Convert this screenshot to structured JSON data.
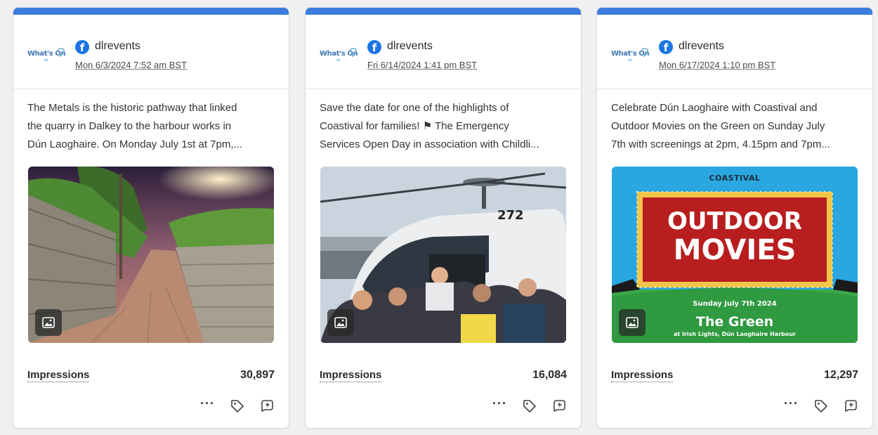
{
  "cards": [
    {
      "logo_text": "What's On",
      "logo_sub": "dlr",
      "platform_icon": "facebook-icon",
      "account": "dlrevents",
      "date": "Mon 6/3/2024 7:52 am BST",
      "text_lines": [
        "The Metals is the historic pathway that linked",
        "the quarry in Dalkey to the harbour works in",
        "Dún Laoghaire. On Monday July 1st at 7pm,..."
      ],
      "impressions_label": "Impressions",
      "impressions_value": "30,897",
      "more_label": "···"
    },
    {
      "logo_text": "What's On",
      "logo_sub": "dlr",
      "platform_icon": "facebook-icon",
      "account": "dlrevents",
      "date": "Fri 6/14/2024 1:41 pm BST",
      "text_lines": [
        "Save the date for one of the highlights of",
        "Coastival for families! ⚑ The Emergency",
        "Services Open Day in association with Childli..."
      ],
      "photo_number": "272",
      "impressions_label": "Impressions",
      "impressions_value": "16,084",
      "more_label": "···"
    },
    {
      "logo_text": "What's On",
      "logo_sub": "dlr",
      "platform_icon": "facebook-icon",
      "account": "dlrevents",
      "date": "Mon 6/17/2024 1:10 pm BST",
      "text_lines": [
        "Celebrate Dún Laoghaire with Coastival and",
        "Outdoor Movies on the Green on Sunday July",
        "7th with screenings at 2pm, 4.15pm and 7pm..."
      ],
      "poster": {
        "brand": "COASTIVAL",
        "line1": "OUTDOOR",
        "line2": "MOVIES",
        "date": "Sunday July 7th 2024",
        "venue": "The Green",
        "venue_sub": "at Irish Lights, Dún Laoghaire Harbour"
      },
      "impressions_label": "Impressions",
      "impressions_value": "12,297",
      "more_label": "···"
    }
  ],
  "colors": {
    "accent_bar": "#3b7ddd",
    "facebook": "#1b74e4"
  }
}
